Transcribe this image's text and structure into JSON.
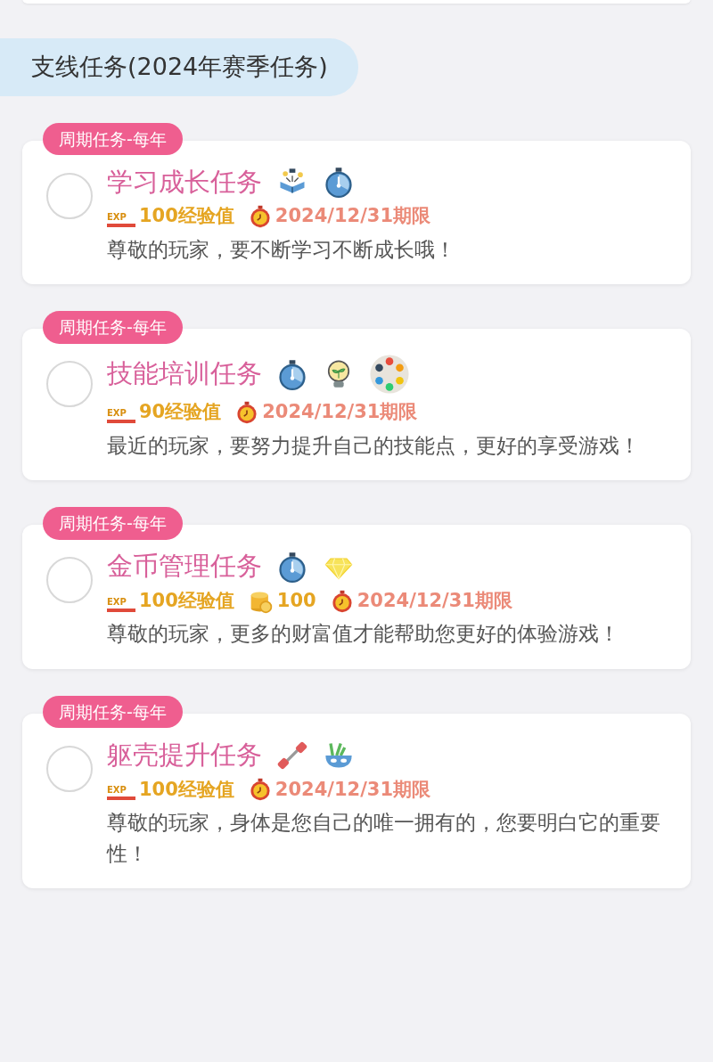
{
  "section": {
    "title": "支线任务(2024年赛季任务)"
  },
  "tasks": [
    {
      "tag": "周期任务-每年",
      "checked": false,
      "title": "学习成长任务",
      "icons": [
        {
          "kind": "book"
        },
        {
          "kind": "stopwatch"
        }
      ],
      "rewards": [
        {
          "kind": "exp",
          "badge": "EXP",
          "text": "100经验值"
        },
        {
          "kind": "deadline",
          "text": "2024/12/31期限"
        }
      ],
      "description": "尊敬的玩家，要不断学习不断成长哦！"
    },
    {
      "tag": "周期任务-每年",
      "checked": false,
      "title": "技能培训任务",
      "icons": [
        {
          "kind": "stopwatch"
        },
        {
          "kind": "bulb"
        },
        {
          "kind": "palette"
        }
      ],
      "rewards": [
        {
          "kind": "exp",
          "badge": "EXP",
          "text": "90经验值"
        },
        {
          "kind": "deadline",
          "text": "2024/12/31期限"
        }
      ],
      "description": "最近的玩家，要努力提升自己的技能点，更好的享受游戏！"
    },
    {
      "tag": "周期任务-每年",
      "checked": false,
      "title": "金币管理任务",
      "icons": [
        {
          "kind": "stopwatch"
        },
        {
          "kind": "diamond"
        }
      ],
      "rewards": [
        {
          "kind": "exp",
          "badge": "EXP",
          "text": "100经验值"
        },
        {
          "kind": "coin",
          "text": "100"
        },
        {
          "kind": "deadline",
          "text": "2024/12/31期限"
        }
      ],
      "description": "尊敬的玩家，更多的财富值才能帮助您更好的体验游戏！"
    },
    {
      "tag": "周期任务-每年",
      "checked": false,
      "title": "躯壳提升任务",
      "icons": [
        {
          "kind": "dumbbell"
        },
        {
          "kind": "mask"
        }
      ],
      "rewards": [
        {
          "kind": "exp",
          "badge": "EXP",
          "text": "100经验值"
        },
        {
          "kind": "deadline",
          "text": "2024/12/31期限"
        }
      ],
      "description": "尊敬的玩家，身体是您自己的唯一拥有的，您要明白它的重要性！"
    }
  ]
}
